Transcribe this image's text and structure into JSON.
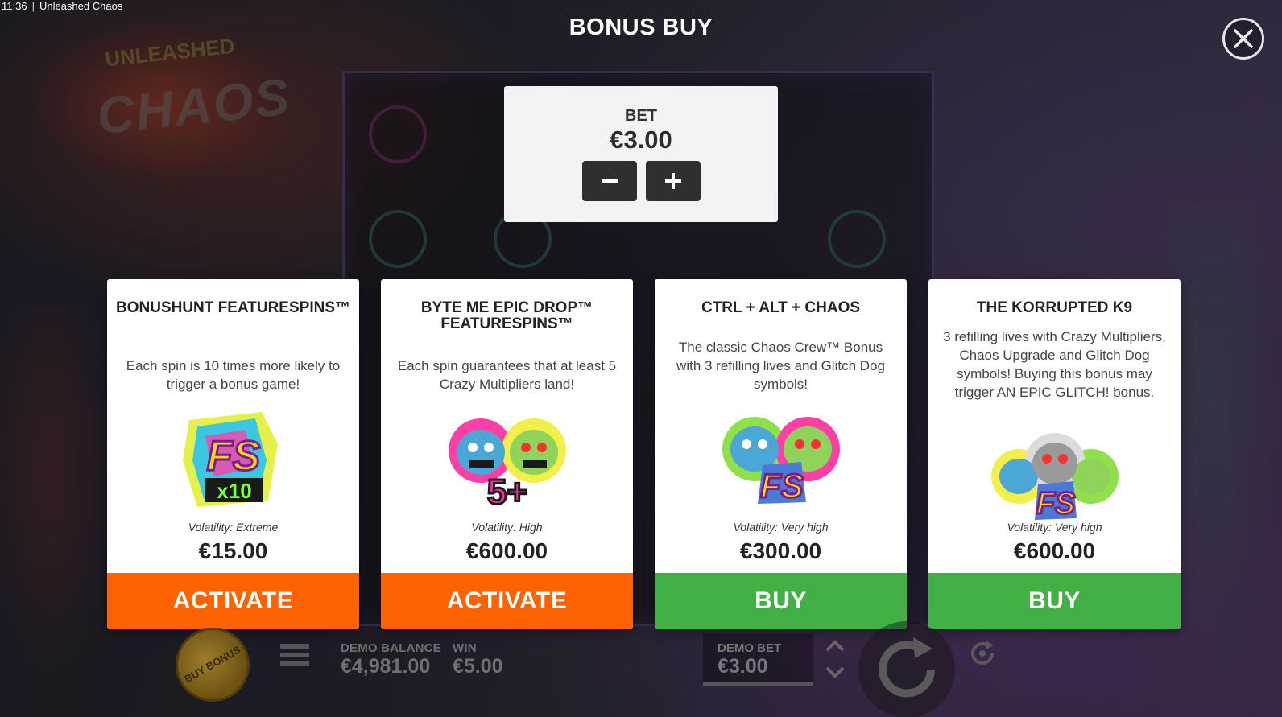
{
  "status_bar": {
    "time": "11:36",
    "separator": "|",
    "app_title": "Unleashed Chaos"
  },
  "background": {
    "logo_top": "UNLEASHED",
    "logo_main": "CHAOS"
  },
  "modal": {
    "title": "BONUS BUY",
    "close_icon": "close-icon",
    "bet": {
      "label": "BET",
      "value": "€3.00",
      "decrease_icon": "minus-icon",
      "increase_icon": "plus-icon"
    }
  },
  "cards": [
    {
      "title": "BONUSHUNT FEATURESPINS™",
      "description": "Each spin is 10 times more likely to trigger a bonus game!",
      "art_icon": "fs-x10-icon",
      "art_text": "FS",
      "art_sub": "x10",
      "volatility": "Volatility: Extreme",
      "price": "€15.00",
      "action": "ACTIVATE",
      "action_color": "#ff6200"
    },
    {
      "title": "BYTE ME EPIC DROP™ FEATURESPINS™",
      "description": "Each spin guarantees that at least 5 Crazy Multipliers land!",
      "art_icon": "five-plus-icon",
      "art_text": "5+",
      "volatility": "Volatility: High",
      "price": "€600.00",
      "action": "ACTIVATE",
      "action_color": "#ff6200"
    },
    {
      "title": "CTRL + ALT + CHAOS",
      "description": "The classic Chaos Crew™ Bonus with 3 refilling lives and Glitch Dog symbols!",
      "art_icon": "fs-duo-icon",
      "art_text": "FS",
      "volatility": "Volatility: Very high",
      "price": "€300.00",
      "action": "BUY",
      "action_color": "#43b045"
    },
    {
      "title": "THE KORRUPTED K9",
      "description": "3 refilling lives with Crazy Multipliers, Chaos Upgrade and Glitch Dog symbols! Buying this bonus may trigger AN EPIC GLITCH! bonus.",
      "art_icon": "fs-trio-icon",
      "art_text": "FS",
      "volatility": "Volatility: Very high",
      "price": "€600.00",
      "action": "BUY",
      "action_color": "#43b045"
    }
  ],
  "hud": {
    "buy_bonus": "BUY BONUS",
    "menu_icon": "hamburger-menu-icon",
    "demo_balance_label": "DEMO BALANCE",
    "demo_balance_value": "€4,981.00",
    "win_label": "WIN",
    "win_value": "€5.00",
    "demo_bet_label": "DEMO BET",
    "demo_bet_value": "€3.00",
    "bet_arrows_icon": "up-down-chevron-icon",
    "spin_icon": "spin-icon",
    "autoplay_icon": "autoplay-icon"
  }
}
